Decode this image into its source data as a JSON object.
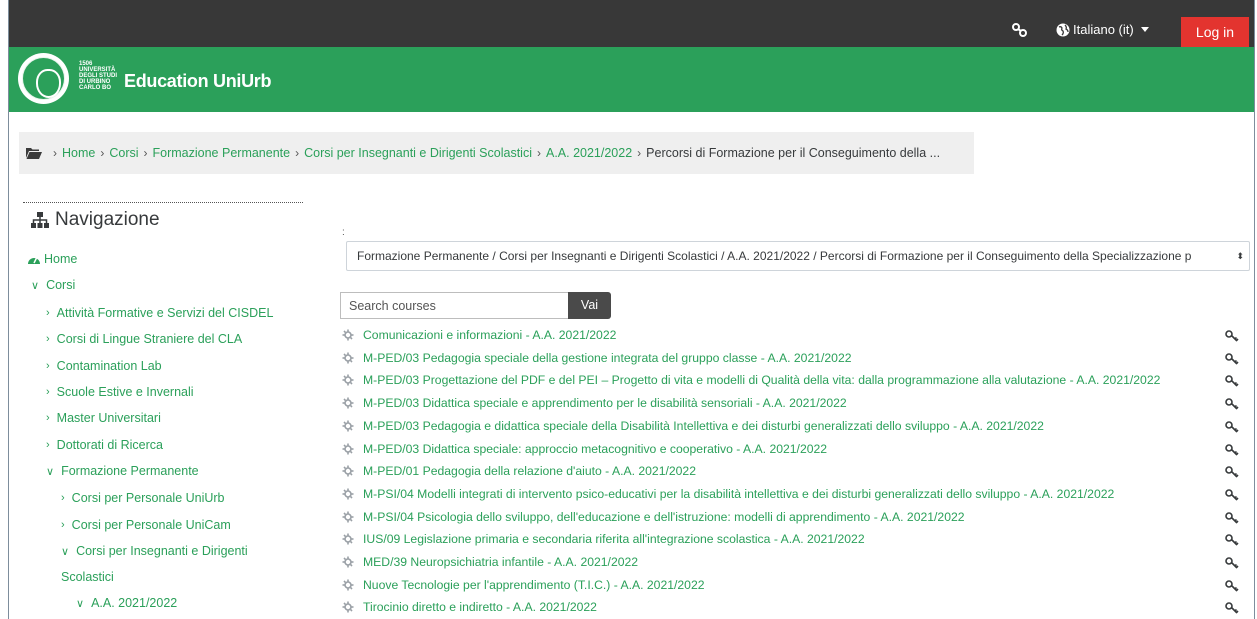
{
  "topbar": {
    "language": "Italiano (it)",
    "login": "Log in"
  },
  "header": {
    "logo_text": [
      "1506",
      "UNIVERSITÀ",
      "DEGLI STUDI",
      "DI URBINO",
      "CARLO BO"
    ],
    "site_title": "Education UniUrb"
  },
  "breadcrumb": {
    "items": [
      "Home",
      "Corsi",
      "Formazione Permanente",
      "Corsi per Insegnanti e Dirigenti Scolastici",
      "A.A. 2021/2022"
    ],
    "current": "Percorsi di Formazione per il Conseguimento della ..."
  },
  "navigation": {
    "title": "Navigazione",
    "home": "Home",
    "corsi": "Corsi",
    "items": [
      "Attività Formative e Servizi del CISDEL",
      "Corsi di Lingue Straniere del CLA",
      "Contamination Lab",
      "Scuole Estive e Invernali",
      "Master Universitari",
      "Dottorati di Ricerca",
      "Formazione Permanente",
      "Corsi per Personale UniUrb",
      "Corsi per Personale UniCam",
      "Corsi per Insegnanti e Dirigenti",
      "Scolastici",
      "A.A. 2021/2022"
    ]
  },
  "main": {
    "select_label": ":",
    "category_select": "Formazione Permanente / Corsi per Insegnanti e Dirigenti Scolastici / A.A. 2021/2022 / Percorsi di Formazione per il Conseguimento della Specializzazione p",
    "search_placeholder": "Search courses",
    "search_button": "Vai",
    "courses": [
      "Comunicazioni e informazioni - A.A. 2021/2022",
      "M-PED/03 Pedagogia speciale della gestione integrata del gruppo classe - A.A. 2021/2022",
      "M-PED/03 Progettazione del PDF e del PEI – Progetto di vita e modelli di Qualità della vita: dalla programmazione alla valutazione - A.A. 2021/2022",
      "M-PED/03 Didattica speciale e apprendimento per le disabilità sensoriali - A.A. 2021/2022",
      "M-PED/03 Pedagogia e didattica speciale della Disabilità Intellettiva e dei disturbi generalizzati dello sviluppo - A.A. 2021/2022",
      "M-PED/03 Didattica speciale: approccio metacognitivo e cooperativo - A.A. 2021/2022",
      "M-PED/01 Pedagogia della relazione d'aiuto - A.A. 2021/2022",
      "M-PSI/04 Modelli integrati di intervento psico-educativi per la disabilità intellettiva e dei disturbi generalizzati dello sviluppo - A.A. 2021/2022",
      "M-PSI/04 Psicologia dello sviluppo, dell'educazione e dell'istruzione: modelli di apprendimento - A.A. 2021/2022",
      "IUS/09 Legislazione primaria e secondaria riferita all'integrazione scolastica - A.A. 2021/2022",
      "MED/39 Neuropsichiatria infantile - A.A. 2021/2022",
      "Nuove Tecnologie per l'apprendimento (T.I.C.) - A.A. 2021/2022",
      "Tirocinio diretto e indiretto - A.A. 2021/2022"
    ]
  },
  "colors": {
    "topbar": "#383838",
    "brand_green": "#2ba05a",
    "login_red": "#e3342f"
  },
  "icons": {
    "share": "share-icon",
    "language": "globe-icon",
    "breadcrumb": "folder-open-icon",
    "nav_title": "sitemap-icon",
    "home": "tachometer-icon",
    "course": "course-gear-icon",
    "guest_access": "key-icon"
  }
}
